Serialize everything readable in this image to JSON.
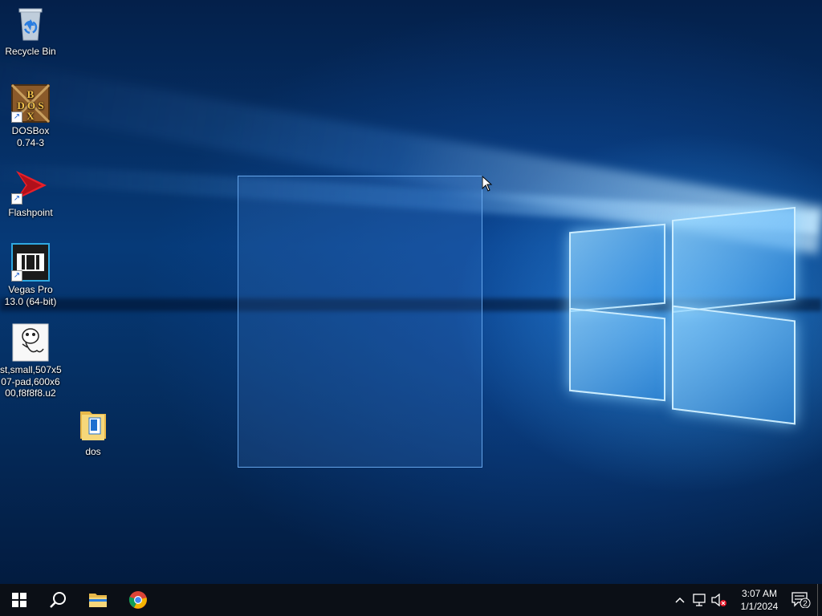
{
  "desktop": {
    "icons": [
      {
        "name": "recycle-bin",
        "label": "Recycle Bin"
      },
      {
        "name": "dosbox",
        "label": "DOSBox\n0.74-3",
        "logo_text": "DOS BOX"
      },
      {
        "name": "flashpoint",
        "label": "Flashpoint"
      },
      {
        "name": "vegas",
        "label": "Vegas Pro\n13.0 (64-bit)"
      },
      {
        "name": "st-image",
        "label": "st,small,507x5\n07-pad,600x6\n00,f8f8f8.u2"
      },
      {
        "name": "dos-folder",
        "label": "dos"
      }
    ]
  },
  "taskbar": {
    "pinned": [
      "windows-start-icon",
      "search-icon",
      "file-explorer-icon",
      "chrome-icon"
    ],
    "tray": {
      "time": "3:07 AM",
      "date": "1/1/2024",
      "notification_count": "2"
    }
  },
  "colors": {
    "accent": "#1a8cff",
    "taskbar": "#0b0f16"
  }
}
